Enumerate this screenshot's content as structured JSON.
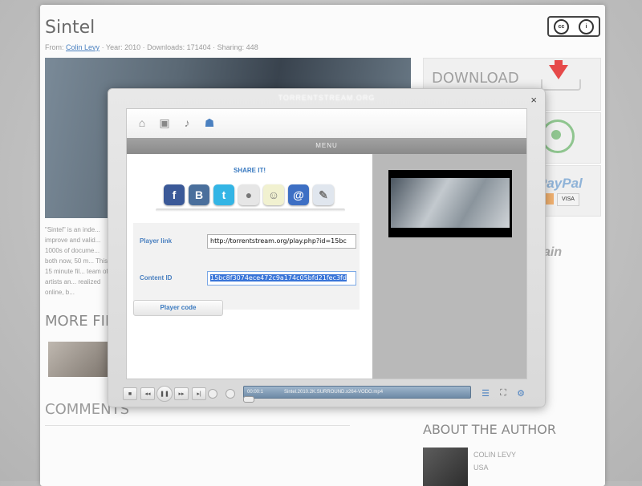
{
  "page": {
    "title": "Sintel",
    "meta_prefix": "From:",
    "author_link": "Colin Levy",
    "meta_rest": "· Year: 2010 · Downloads: 171404 · Sharing: 448",
    "cc_label": "cc",
    "description": "\"Sintel\" is an inde... improve and valid... 1000s of docume... both now, 50 m... This 15 minute fil... team of artists an... realized online, b...",
    "more_films": "MORE FIL",
    "comments": "COMMENTS",
    "download": "DOWNLOAD",
    "paypal": "PayPal",
    "visa": "VISA",
    "main_text": "ain",
    "about_author": "ABOUT THE AUTHOR",
    "author_name": "COLIN LEVY",
    "author_country": "USA"
  },
  "dialog": {
    "title": "TORRENTSTREAM.ORG",
    "close": "×",
    "menu": "MENU",
    "share_title": "SHARE IT!",
    "player_link_label": "Player link",
    "player_link_value": "http://torrentstream.org/play.php?id=15bc",
    "content_id_label": "Content ID",
    "content_id_value": "15bc8f3074ece472c9a174c05bfd21fec3fd",
    "player_code_button": "Player code",
    "toolbar_icons": [
      "home-icon",
      "film-icon",
      "music-icon",
      "share-icon"
    ],
    "social": [
      {
        "name": "facebook",
        "glyph": "f",
        "color": "#3b5998"
      },
      {
        "name": "vkontakte",
        "glyph": "B",
        "color": "#4a6f9c"
      },
      {
        "name": "twitter",
        "glyph": "t",
        "color": "#33b5e5"
      },
      {
        "name": "google-buzz",
        "glyph": "●",
        "color": "#e6e6e6"
      },
      {
        "name": "odnoklassniki",
        "glyph": "☺",
        "color": "#f1f1d0"
      },
      {
        "name": "moi-mir",
        "glyph": "@",
        "color": "#3d6fc4"
      },
      {
        "name": "livejournal",
        "glyph": "✎",
        "color": "#e0e6ee"
      }
    ]
  },
  "player": {
    "time": "00:00:1",
    "file": "Sintel.2010.2K.SURROUND.x264-VODO.mp4",
    "buttons": [
      "stop",
      "prev",
      "pause",
      "next",
      "end"
    ],
    "colors": {
      "seek": "#6e8aa6",
      "accent": "#4a80c0"
    }
  }
}
